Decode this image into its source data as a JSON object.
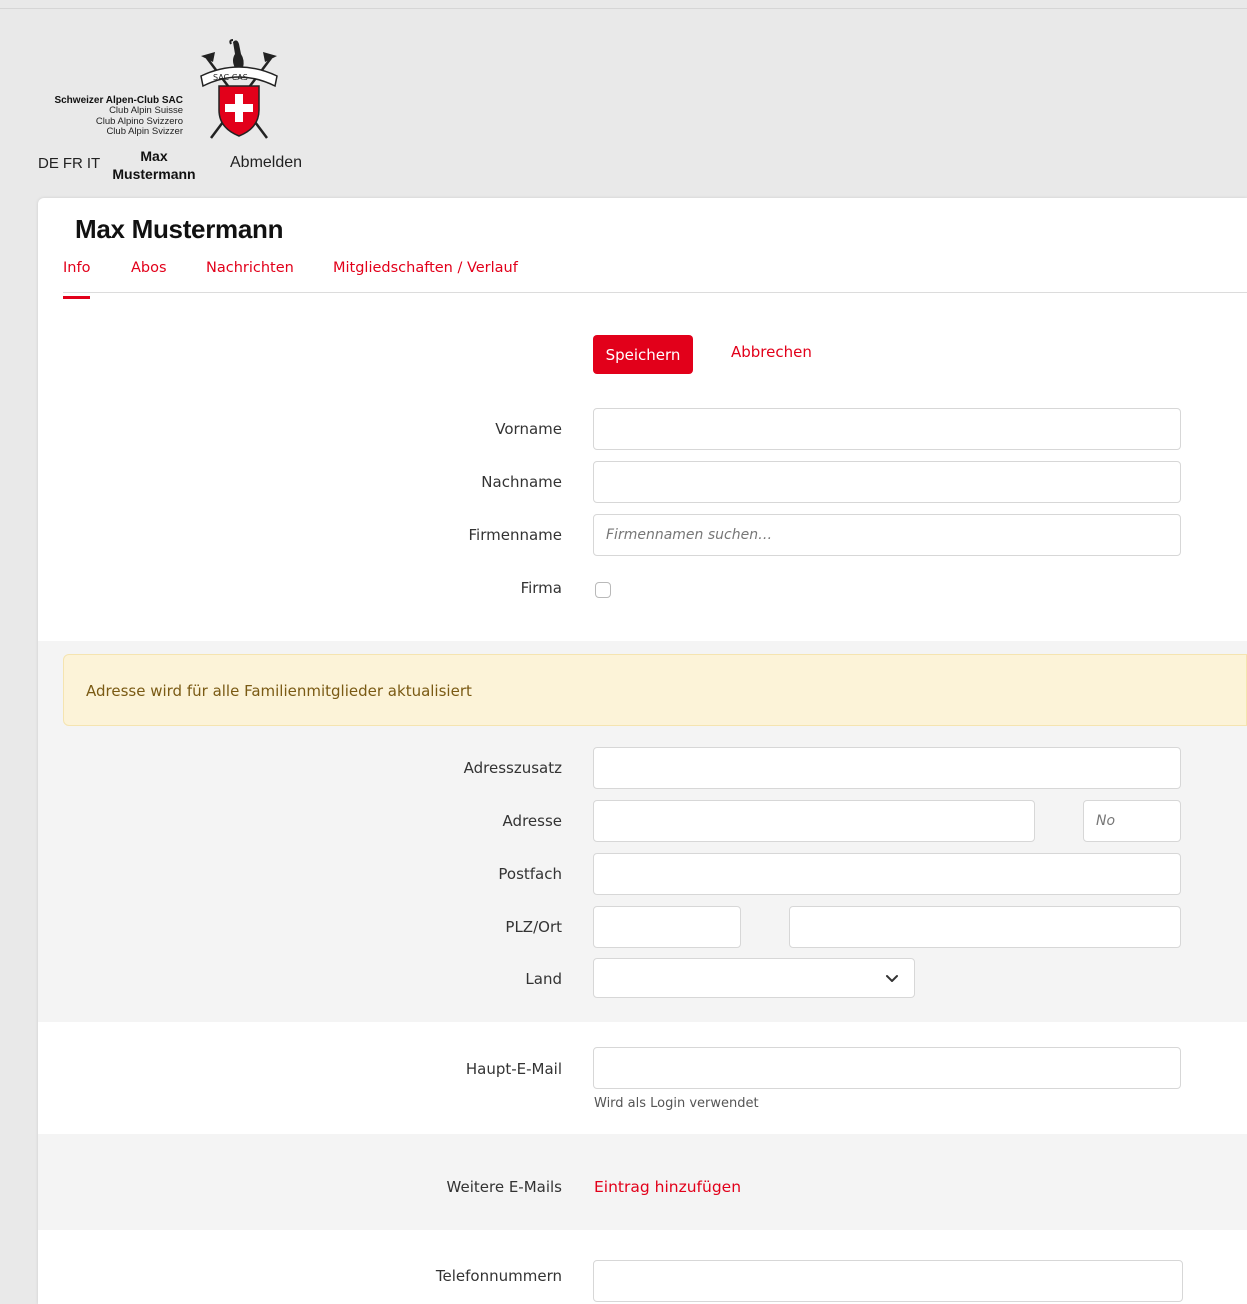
{
  "brand": {
    "line1": "Schweizer Alpen-Club SAC",
    "line2": "Club Alpin Suisse",
    "line3": "Club Alpino Svizzero",
    "line4": "Club Alpin Svizzer",
    "logo_text": "SAC CAS"
  },
  "header": {
    "languages": [
      "DE",
      "FR",
      "IT"
    ],
    "user_first": "Max",
    "user_last": "Mustermann",
    "logout": "Abmelden"
  },
  "page": {
    "title": "Max Mustermann",
    "tabs": [
      {
        "label": "Info"
      },
      {
        "label": "Abos"
      },
      {
        "label": "Nachrichten"
      },
      {
        "label": "Mitgliedschaften / Verlauf"
      }
    ]
  },
  "actions": {
    "save": "Speichern",
    "cancel": "Abbrechen"
  },
  "form": {
    "vorname": {
      "label": "Vorname",
      "value": ""
    },
    "nachname": {
      "label": "Nachname",
      "value": ""
    },
    "firmenname": {
      "label": "Firmenname",
      "placeholder": "Firmennamen suchen…",
      "value": ""
    },
    "firma": {
      "label": "Firma",
      "checked": false
    },
    "notice": "Adresse wird für alle Familienmitglieder aktualisiert",
    "adresszusatz": {
      "label": "Adresszusatz",
      "value": ""
    },
    "adresse": {
      "label": "Adresse",
      "value": "",
      "number_placeholder": "No"
    },
    "postfach": {
      "label": "Postfach",
      "value": ""
    },
    "plz_ort": {
      "label": "PLZ/Ort",
      "plz": "",
      "ort": ""
    },
    "land": {
      "label": "Land",
      "value": ""
    },
    "haupt_email": {
      "label": "Haupt-E-Mail",
      "value": "",
      "hint": "Wird als Login verwendet"
    },
    "weitere_emails": {
      "label": "Weitere E-Mails",
      "add_link": "Eintrag hinzufügen"
    },
    "telefon": {
      "label": "Telefonnummern",
      "value": ""
    }
  },
  "colors": {
    "accent": "#e2001a",
    "notice_bg": "#fcf3d8",
    "notice_text": "#7a5a14"
  }
}
